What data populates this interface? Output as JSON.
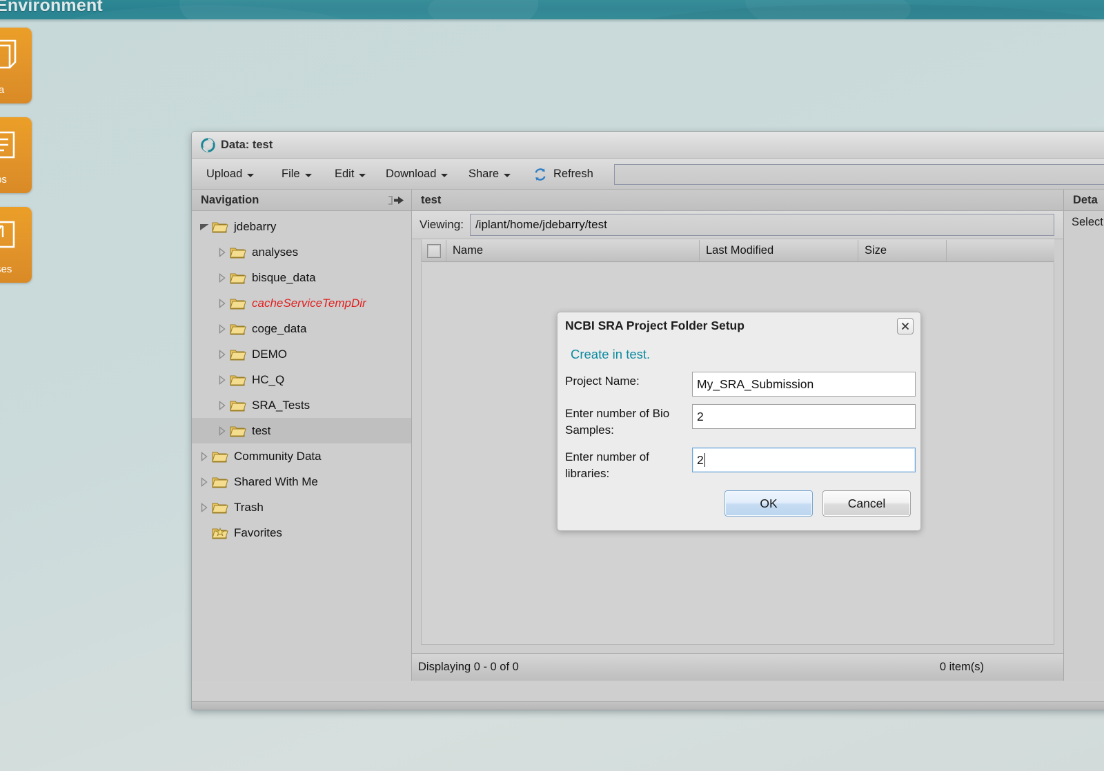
{
  "app": {
    "header_title": "covery Environment",
    "header_color": "#2a8290",
    "tiles": [
      {
        "name": "data-tile",
        "label": "a",
        "icon": "data-stack-icon"
      },
      {
        "name": "apps-tile",
        "label": "ps",
        "icon": "apps-list-icon"
      },
      {
        "name": "analyses-tile",
        "label": "yses",
        "icon": "analyses-chart-icon"
      }
    ]
  },
  "window": {
    "title": "Data: test",
    "icon": "iplant-swirl-icon",
    "toolbar": {
      "menus": [
        {
          "label": "Upload",
          "name": "upload-menu"
        },
        {
          "label": "File",
          "name": "file-menu"
        },
        {
          "label": "Edit",
          "name": "edit-menu"
        },
        {
          "label": "Download",
          "name": "download-menu"
        },
        {
          "label": "Share",
          "name": "share-menu"
        }
      ],
      "refresh_label": "Refresh",
      "refresh_icon": "refresh-circular-arrows-icon",
      "search_value": "",
      "search_placeholder": ""
    }
  },
  "navigation": {
    "header": "Navigation",
    "collapse_icon": "collapse-left-arrow-icon",
    "items": [
      {
        "label": "jdebarry",
        "depth": 0,
        "state": "expanded",
        "selected": false,
        "warn": false,
        "icon": "folder-icon"
      },
      {
        "label": "analyses",
        "depth": 1,
        "state": "collapsed",
        "selected": false,
        "warn": false,
        "icon": "folder-icon"
      },
      {
        "label": "bisque_data",
        "depth": 1,
        "state": "collapsed",
        "selected": false,
        "warn": false,
        "icon": "folder-icon"
      },
      {
        "label": "cacheServiceTempDir",
        "depth": 1,
        "state": "collapsed",
        "selected": false,
        "warn": true,
        "icon": "folder-icon"
      },
      {
        "label": "coge_data",
        "depth": 1,
        "state": "collapsed",
        "selected": false,
        "warn": false,
        "icon": "folder-icon"
      },
      {
        "label": "DEMO",
        "depth": 1,
        "state": "collapsed",
        "selected": false,
        "warn": false,
        "icon": "folder-icon"
      },
      {
        "label": "HC_Q",
        "depth": 1,
        "state": "collapsed",
        "selected": false,
        "warn": false,
        "icon": "folder-icon"
      },
      {
        "label": "SRA_Tests",
        "depth": 1,
        "state": "collapsed",
        "selected": false,
        "warn": false,
        "icon": "folder-icon"
      },
      {
        "label": "test",
        "depth": 1,
        "state": "collapsed",
        "selected": true,
        "warn": false,
        "icon": "folder-icon"
      },
      {
        "label": "Community Data",
        "depth": 0,
        "state": "collapsed",
        "selected": false,
        "warn": false,
        "icon": "folder-icon"
      },
      {
        "label": "Shared With Me",
        "depth": 0,
        "state": "collapsed",
        "selected": false,
        "warn": false,
        "icon": "folder-icon"
      },
      {
        "label": "Trash",
        "depth": 0,
        "state": "collapsed",
        "selected": false,
        "warn": false,
        "icon": "folder-icon"
      },
      {
        "label": "Favorites",
        "depth": 0,
        "state": "leaf",
        "selected": false,
        "warn": false,
        "icon": "folder-star-icon"
      }
    ]
  },
  "center": {
    "header": "test",
    "viewing_label": "Viewing:",
    "viewing_path": "/iplant/home/jdebarry/test",
    "columns": [
      "Name",
      "Last Modified",
      "Size"
    ],
    "rows": [],
    "status_left": "Displaying 0 - 0 of 0",
    "status_right": "0 item(s)"
  },
  "details": {
    "header": "Deta",
    "body": "Select"
  },
  "dialog": {
    "title": "NCBI SRA Project Folder Setup",
    "close_icon": "close-x-icon",
    "subtitle": "Create in test.",
    "subtitle_color": "#0c8aa0",
    "fields": [
      {
        "name": "project-name-field",
        "label": "Project Name:",
        "value": "My_SRA_Submission",
        "focused": false
      },
      {
        "name": "bio-samples-field",
        "label": "Enter number of Bio Samples:",
        "value": "2",
        "focused": false
      },
      {
        "name": "libraries-field",
        "label": "Enter number of libraries:",
        "value": "2",
        "focused": true
      }
    ],
    "ok_label": "OK",
    "cancel_label": "Cancel"
  }
}
